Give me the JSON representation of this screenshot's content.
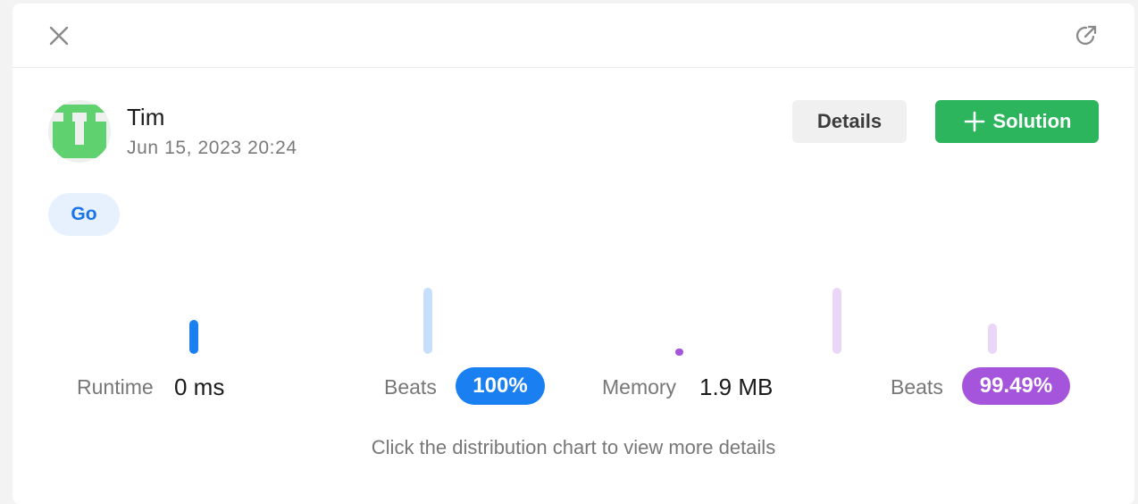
{
  "header": {
    "close_icon": "close-icon",
    "share_icon": "open-external-icon"
  },
  "user": {
    "name": "Tim",
    "date": "Jun 15, 2023 20:24",
    "avatar_icon": "user-avatar"
  },
  "actions": {
    "details_label": "Details",
    "solution_label": "Solution",
    "solution_icon": "plus-icon"
  },
  "language": "Go",
  "stats": {
    "runtime_label": "Runtime",
    "runtime_value": "0 ms",
    "runtime_beats_label": "Beats",
    "runtime_beats_value": "100%",
    "memory_label": "Memory",
    "memory_value": "1.9 MB",
    "memory_beats_label": "Beats",
    "memory_beats_value": "99.49%"
  },
  "hint": "Click the distribution chart to view more details",
  "colors": {
    "accent_green": "#2db55d",
    "runtime_blue": "#1a7ff0",
    "runtime_blue_light": "#c6e0fb",
    "memory_purple": "#a555dc",
    "memory_purple_light": "#ead6f6",
    "lang_tag_text": "#1a73e8",
    "lang_tag_bg": "#e6f1fd"
  }
}
